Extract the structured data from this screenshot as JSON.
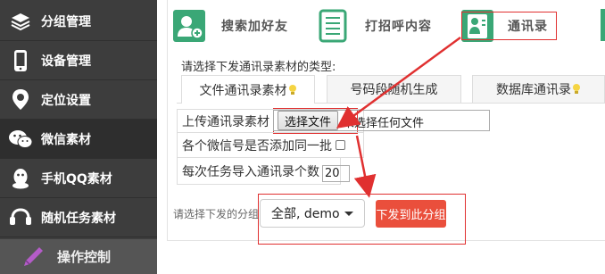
{
  "sidebar": {
    "items": [
      {
        "label": "分组管理",
        "icon": "layers-icon"
      },
      {
        "label": "设备管理",
        "icon": "phone-icon"
      },
      {
        "label": "定位设置",
        "icon": "location-icon"
      },
      {
        "label": "微信素材",
        "icon": "wechat-icon",
        "active": true
      },
      {
        "label": "手机QQ素材",
        "icon": "qq-icon"
      },
      {
        "label": "随机任务素材",
        "icon": "task-icon"
      }
    ],
    "footer_label": "操作控制",
    "footer_icon": "pen-icon"
  },
  "toolbar": {
    "search_friend": "搜索加好友",
    "greeting": "打招呼内容",
    "contacts": "通讯录"
  },
  "prompt": "请选择下发通讯录素材的类型:",
  "tabs": [
    {
      "label": "文件通讯录素材",
      "active": true
    },
    {
      "label": "号码段随机生成",
      "active": false
    },
    {
      "label": "数据库通讯录",
      "active": false
    }
  ],
  "form": {
    "upload_label": "上传通讯录素材",
    "choose_file_button": "选择文件",
    "no_file_text": "未选择任何文件",
    "same_batch_label": "各个微信号是否添加同一批",
    "same_batch_checked": false,
    "per_task_label": "每次任务导入通讯录个数",
    "per_task_value": "20"
  },
  "dispatch": {
    "group_label": "请选择下发的分组",
    "group_selected": "全部, demo",
    "send_button": "下发到此分组"
  },
  "colors": {
    "sidebar_bg": "#3d3d3d",
    "accent_green": "#3aa776",
    "send_button": "#ea4f3c",
    "annotation_red": "#e03030"
  }
}
